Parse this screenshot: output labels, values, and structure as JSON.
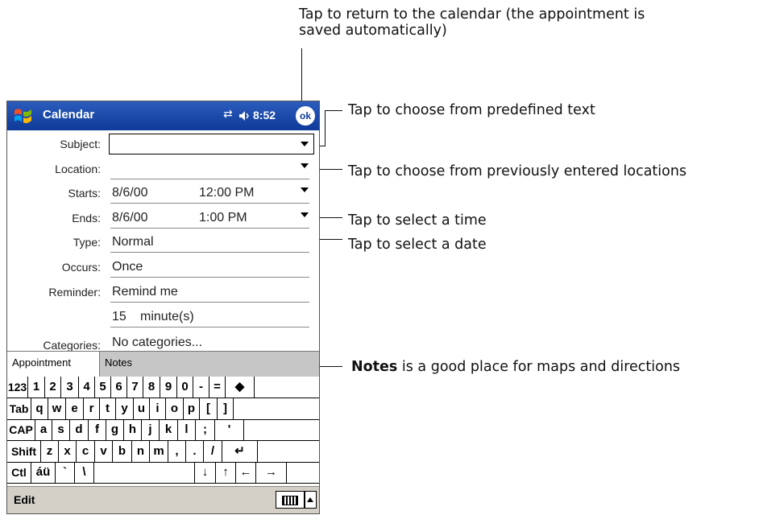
{
  "annotations": {
    "top_line1": "Tap to return to the calendar (the appointment is",
    "top_line2": "saved automatically)",
    "predefined": "Tap to choose from predefined text",
    "locations": "Tap to choose from previously entered locations",
    "time": "Tap to select a time",
    "date": "Tap to select a date",
    "notes_bold": "Notes",
    "notes_rest": " is a good place for maps and directions"
  },
  "titlebar": {
    "app": "Calendar",
    "time": "8:52",
    "ok": "ok"
  },
  "form": {
    "subject": {
      "label": "Subject:",
      "value": ""
    },
    "location": {
      "label": "Location:",
      "value": ""
    },
    "starts": {
      "label": "Starts:",
      "date": "8/6/00",
      "time": "12:00 PM"
    },
    "ends": {
      "label": "Ends:",
      "date": "8/6/00",
      "time": "1:00 PM"
    },
    "type": {
      "label": "Type:",
      "value": "Normal"
    },
    "occurs": {
      "label": "Occurs:",
      "value": "Once"
    },
    "reminder": {
      "label": "Reminder:",
      "value": "Remind me",
      "amount": "15",
      "unit": "minute(s)"
    },
    "categories": {
      "label": "Categories:",
      "value": "No categories..."
    }
  },
  "tabs": [
    "Appointment",
    "Notes"
  ],
  "keyboard": {
    "rows": [
      [
        "123",
        "1",
        "2",
        "3",
        "4",
        "5",
        "6",
        "7",
        "8",
        "9",
        "0",
        "-",
        "=",
        "◆"
      ],
      [
        "Tab",
        "q",
        "w",
        "e",
        "r",
        "t",
        "y",
        "u",
        "i",
        "o",
        "p",
        "[",
        "]"
      ],
      [
        "CAP",
        "a",
        "s",
        "d",
        "f",
        "g",
        "h",
        "j",
        "k",
        "l",
        ";",
        "'"
      ],
      [
        "Shift",
        "z",
        "x",
        "c",
        "v",
        "b",
        "n",
        "m",
        ",",
        ".",
        "/",
        "↵"
      ],
      [
        "Ctl",
        "áü",
        "`",
        "\\",
        "",
        "↓",
        "↑",
        "←",
        "→"
      ]
    ]
  },
  "menubar": {
    "edit": "Edit"
  }
}
